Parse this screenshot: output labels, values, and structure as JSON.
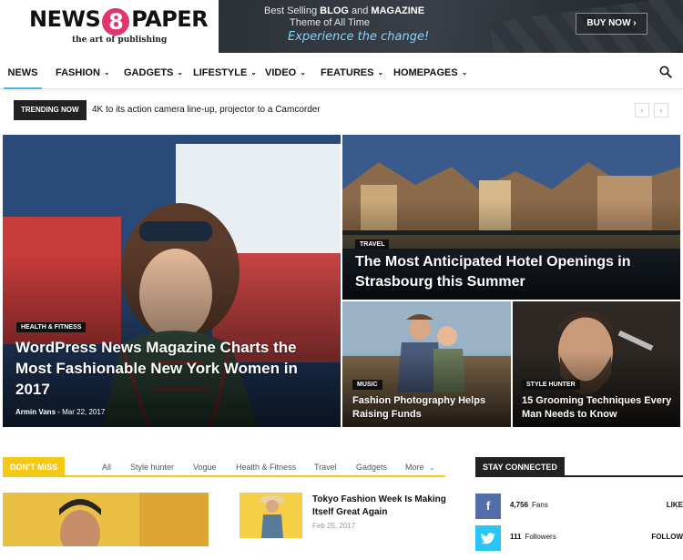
{
  "logo": {
    "word1": "NEWS",
    "number": "8",
    "word2": "PAPER",
    "tagline": "the art of publishing"
  },
  "banner": {
    "line1_prefix": "Best Selling ",
    "line1_bold1": "BLOG",
    "line1_mid": " and ",
    "line1_bold2": "MAGAZINE",
    "line2": "Theme of All Time",
    "line3": "Experience the change!",
    "button": "BUY NOW ›"
  },
  "nav": {
    "items": [
      {
        "label": "NEWS"
      },
      {
        "label": "FASHION"
      },
      {
        "label": "GADGETS"
      },
      {
        "label": "LIFESTYLE"
      },
      {
        "label": "VIDEO"
      },
      {
        "label": "FEATURES"
      },
      {
        "label": "HOMEPAGES"
      }
    ],
    "chevron": "⌄",
    "search_icon": "search-icon"
  },
  "trending": {
    "label": "TRENDING NOW",
    "headline": "4K to its action camera line-up, projector to a Camcorder",
    "prev": "‹",
    "next": "›"
  },
  "featured": [
    {
      "category": "HEALTH & FITNESS",
      "title": "WordPress News Magazine Charts the Most Fashionable New York Women in 2017",
      "author": "Armin Vans",
      "date": "Mar 22, 2017"
    },
    {
      "category": "TRAVEL",
      "title": "The Most Anticipated Hotel Openings in Strasbourg this Summer"
    },
    {
      "category": "MUSIC",
      "title": "Fashion Photography Helps Raising Funds"
    },
    {
      "category": "STYLE HUNTER",
      "title": "15 Grooming Techniques Every Man Needs to Know"
    }
  ],
  "dont_miss": {
    "label": "DON'T MISS",
    "tabs": [
      "All",
      "Style hunter",
      "Vogue",
      "Health & Fitness",
      "Travel",
      "Gadgets",
      "More"
    ],
    "article": {
      "title": "Tokyo Fashion Week Is Making Itself Great Again",
      "date": "Feb 25, 2017"
    }
  },
  "stay_connected": {
    "label": "STAY CONNECTED",
    "networks": [
      {
        "icon": "facebook-icon",
        "glyph": "f",
        "count": "4,756",
        "unit": "Fans",
        "action": "LIKE",
        "color": "#516eab"
      },
      {
        "icon": "twitter-icon",
        "glyph": "t",
        "count": "111",
        "unit": "Followers",
        "action": "FOLLOW",
        "color": "#29c5f6"
      }
    ]
  },
  "colors": {
    "accent": "#4db2ec",
    "dont_miss": "#f4c817",
    "logo_circle": "#e0366e"
  }
}
